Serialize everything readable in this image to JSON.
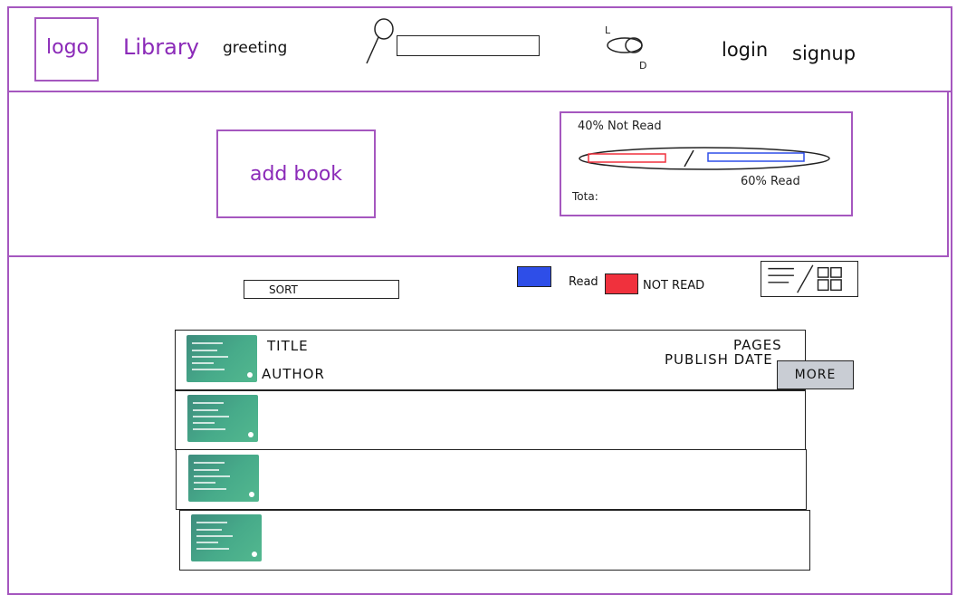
{
  "header": {
    "logo": "logo",
    "title": "Library",
    "greeting": "greeting",
    "search": {
      "value": "",
      "icon": "search-icon"
    },
    "theme_toggle": {
      "light_label": "L",
      "dark_label": "D"
    },
    "login": "login",
    "signup": "signup"
  },
  "top_panel": {
    "add_book": "add book",
    "stats": {
      "not_read": "40% Not Read",
      "read": "60% Read",
      "total": "Tota:",
      "read_fraction": 0.6,
      "not_read_fraction": 0.4
    }
  },
  "controls": {
    "sort": "SORT",
    "legend": [
      {
        "label": "Read",
        "color": "#2e4ee8"
      },
      {
        "label": "NOT READ",
        "color": "#f0313d"
      }
    ],
    "view_toggle": "list-grid-icon"
  },
  "book_list": {
    "rows": [
      {
        "title": "TITLE",
        "author": "AUTHOR",
        "pages": "PAGES",
        "publish_date": "PUBLISH DATE",
        "more": "MORE"
      },
      {},
      {},
      {}
    ]
  },
  "colors": {
    "accent": "#a557bf",
    "accent_text": "#8b2ab8",
    "read": "#2e4ee8",
    "not_read": "#f0313d",
    "more_button": "#c9cdd4",
    "thumbnail": "#47ab8a"
  }
}
